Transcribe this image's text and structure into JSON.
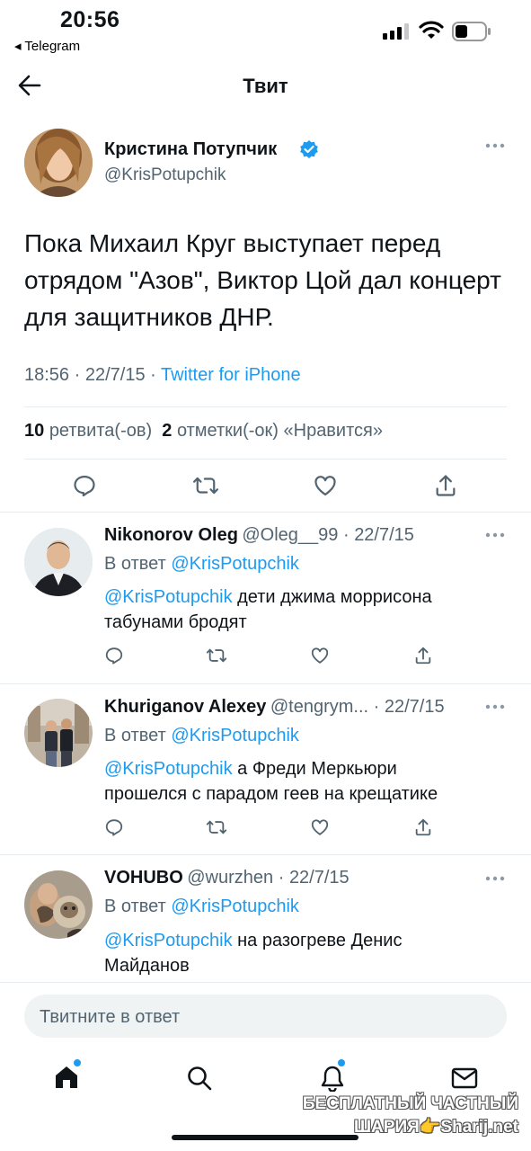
{
  "status_bar": {
    "time": "20:56",
    "back_app": "◂ Telegram"
  },
  "header": {
    "title": "Твит"
  },
  "tweet": {
    "author_name": "Кристина Потупчик",
    "author_handle": "@KrisPotupchik",
    "text": "Пока Михаил Круг выступает перед отрядом \"Азов\", Виктор Цой дал концерт для защитников ДНР.",
    "time": "18:56",
    "date": "22/7/15",
    "source": "Twitter for iPhone",
    "retweets_count": "10",
    "retweets_label": "ретвита(-ов)",
    "likes_count": "2",
    "likes_label": "отметки(-ок) «Нравится»"
  },
  "replies": [
    {
      "name": "Nikonorov Oleg",
      "handle": "@Oleg__99",
      "date": "22/7/15",
      "reply_to_prefix": "В ответ",
      "reply_to": "@KrisPotupchik",
      "mention": "@KrisPotupchik",
      "text": "дети джима моррисона табунами бродят"
    },
    {
      "name": "Khuriganov Alexey",
      "handle": "@tengrym...",
      "date": "22/7/15",
      "reply_to_prefix": "В ответ",
      "reply_to": "@KrisPotupchik",
      "mention": "@KrisPotupchik",
      "text": "а Фреди Меркьюри прошелся с парадом геев на крещатике"
    },
    {
      "name": "VOHUBO",
      "handle": "@wurzhen",
      "date": "22/7/15",
      "reply_to_prefix": "В ответ",
      "reply_to": "@KrisPotupchik",
      "mention": "@KrisPotupchik",
      "text": "на разогреве Денис Майданов"
    }
  ],
  "compose": {
    "placeholder": "Твитните в ответ"
  },
  "watermark": {
    "line1": "БЕСПЛАТНЫЙ ЧАСТНЫЙ",
    "line2": "ШАРИЯ👉Sharij.net"
  },
  "icons": {
    "back": "arrow-left-icon",
    "verified": "verified-badge-icon",
    "more": "more-dots-icon",
    "reply": "reply-icon",
    "retweet": "retweet-icon",
    "like": "heart-icon",
    "share": "share-icon",
    "home": "home-icon",
    "search": "search-icon",
    "notifications": "bell-icon",
    "messages": "mail-icon"
  },
  "colors": {
    "accent": "#1d9bf0",
    "secondary_text": "#536471",
    "text": "#0f1419"
  }
}
